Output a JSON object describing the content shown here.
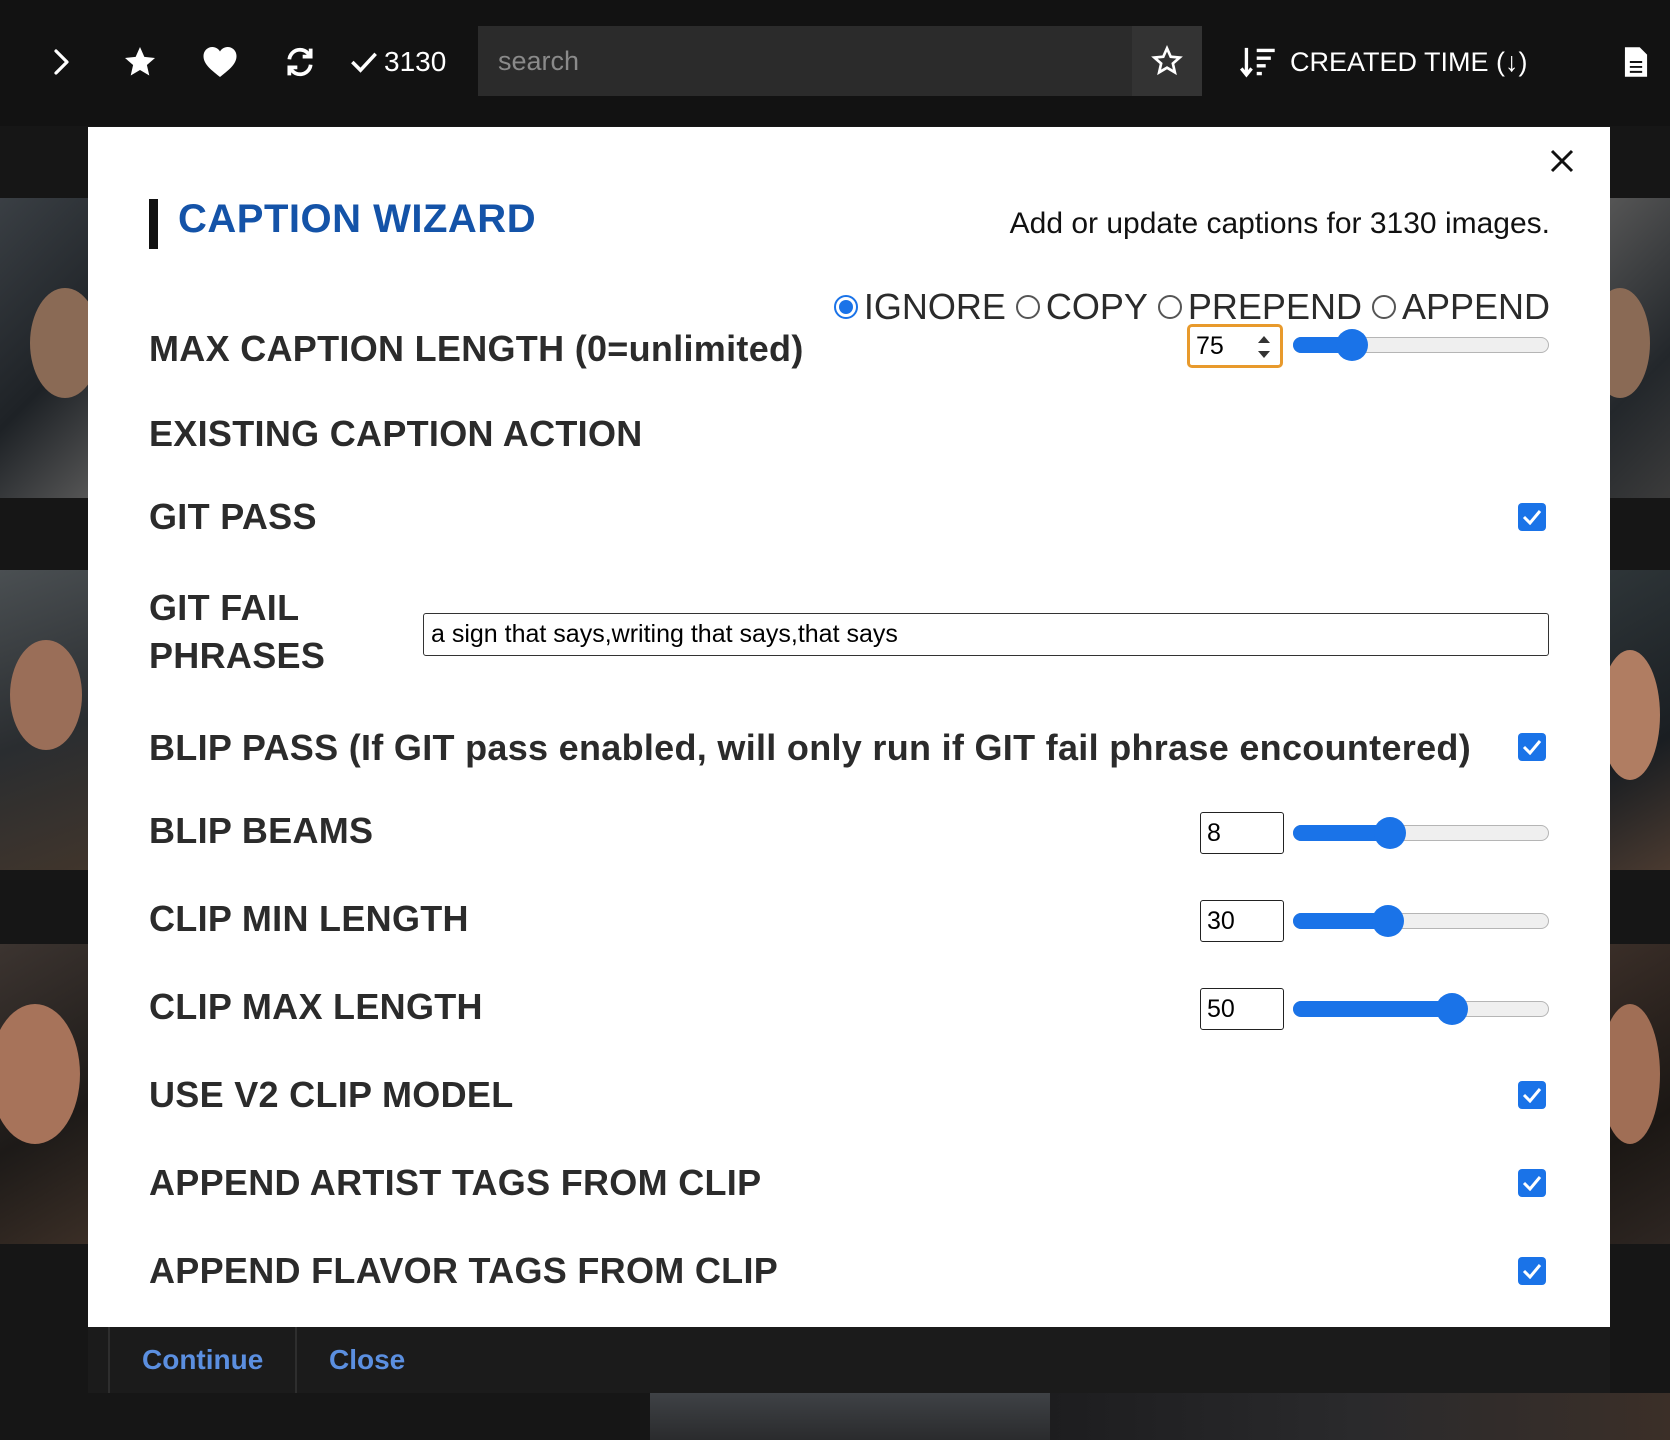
{
  "toolbar": {
    "icons": [
      "chevron-right-icon",
      "star-icon",
      "heart-icon",
      "refresh-icon"
    ],
    "count": "3130",
    "search_placeholder": "search",
    "sort_label": "CREATED TIME (↓)"
  },
  "modal": {
    "title": "CAPTION WIZARD",
    "subtitle": "Add or update captions for 3130 images.",
    "max_caption": {
      "label": "MAX CAPTION LENGTH (0=unlimited)",
      "value": "75",
      "slider_fraction": 0.23
    },
    "existing_action": {
      "label": "EXISTING CAPTION ACTION",
      "options": [
        "IGNORE",
        "COPY",
        "PREPEND",
        "APPEND"
      ],
      "selected": "IGNORE"
    },
    "git_pass": {
      "label": "GIT PASS",
      "checked": true
    },
    "git_fail": {
      "label": "GIT FAIL PHRASES",
      "value": "a sign that says,writing that says,that says"
    },
    "blip_pass": {
      "label": "BLIP PASS (If GIT pass enabled, will only run if GIT fail phrase encountered)",
      "checked": true
    },
    "blip_beams": {
      "label": "BLIP BEAMS",
      "value": "8",
      "slider_fraction": 0.38
    },
    "clip_min": {
      "label": "CLIP MIN LENGTH",
      "value": "30",
      "slider_fraction": 0.37
    },
    "clip_max": {
      "label": "CLIP MAX LENGTH",
      "value": "50",
      "slider_fraction": 0.62
    },
    "use_v2": {
      "label": "USE V2 CLIP MODEL",
      "checked": true
    },
    "artist_tags": {
      "label": "APPEND ARTIST TAGS FROM CLIP",
      "checked": true
    },
    "flavor_tags": {
      "label": "APPEND FLAVOR TAGS FROM CLIP",
      "checked": true
    }
  },
  "footer": {
    "continue_label": "Continue",
    "close_label": "Close"
  },
  "colors": {
    "accent": "#1a73e8",
    "title": "#1453a8",
    "focus": "#e89a2c",
    "footer_link": "#5b8fe0"
  }
}
